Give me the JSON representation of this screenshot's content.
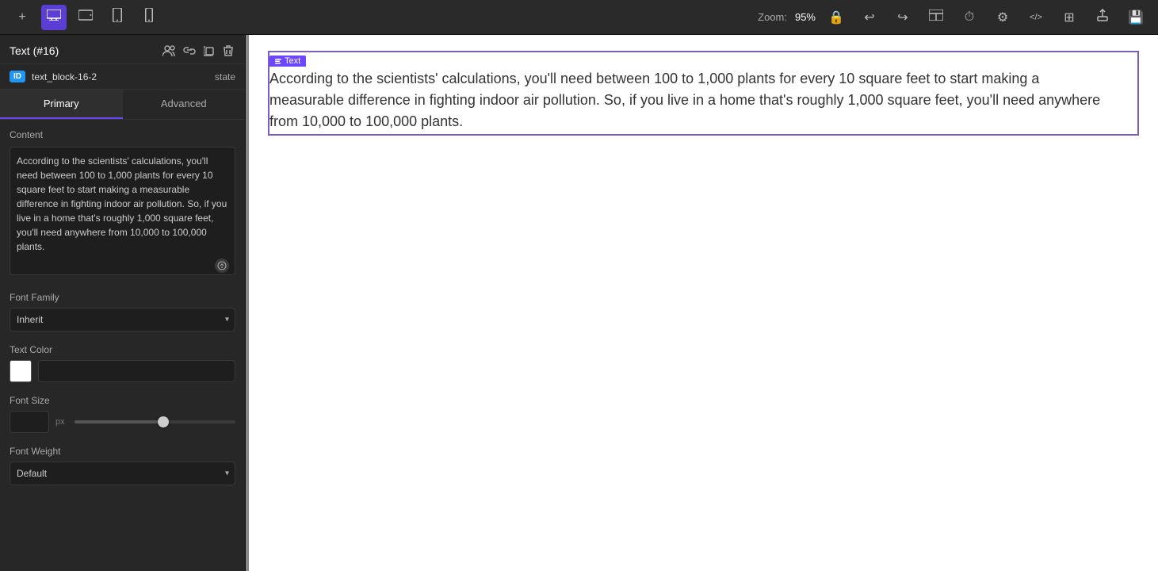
{
  "toolbar": {
    "zoom_label": "Zoom:",
    "zoom_value": "95%",
    "add_icon": "+",
    "desktop_icon": "desktop",
    "tablet_h_icon": "tablet-horizontal",
    "tablet_v_icon": "tablet-vertical",
    "mobile_icon": "mobile"
  },
  "panel": {
    "title": "Text (#16)",
    "id_badge": "ID",
    "id_value": "text_block-16-2",
    "state_label": "state",
    "tabs": [
      "Primary",
      "Advanced"
    ],
    "active_tab": "Primary",
    "section_content": "Content",
    "content_text": "According to the scientists' calculations, you'll need between 100 to 1,000 plants for every 10 square feet to start making a measurable difference in fighting indoor air pollution. So, if you live in a home that's roughly 1,000 square feet, you'll need anywhere from 10,000 to 100,000 plants.",
    "font_family_label": "Font Family",
    "font_family_value": "Inherit",
    "text_color_label": "Text Color",
    "text_color_value": "#ffffff",
    "font_size_label": "Font Size",
    "font_size_value": "",
    "font_size_unit": "px",
    "font_weight_label": "Font Weight"
  },
  "canvas": {
    "text_badge": "Text",
    "body_text": "According to the scientists' calculations, you'll need between 100 to 1,000 plants for every 10 square feet to start making a measurable difference in fighting indoor air pollution. So, if you live in a home that's roughly 1,000 square feet, you'll need anywhere from 10,000 to 100,000 plants."
  }
}
